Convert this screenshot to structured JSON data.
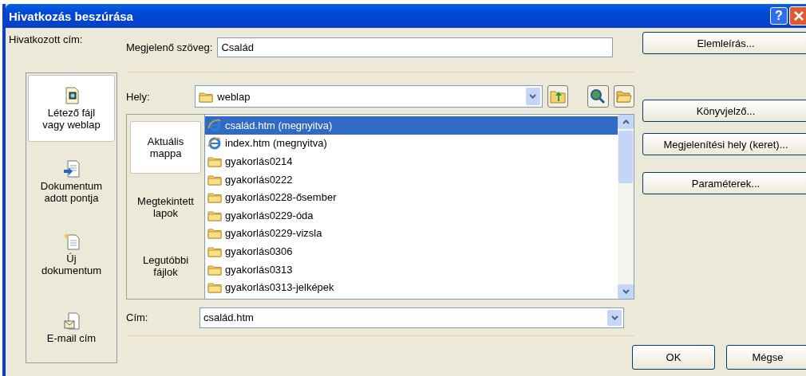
{
  "window": {
    "title": "Hivatkozás beszúrása",
    "help_button": "?"
  },
  "link_to": {
    "label": "Hivatkozott cím:",
    "items": [
      {
        "label": "Létező fájl\nvagy weblap",
        "kind": "file",
        "selected": true
      },
      {
        "label": "Dokumentum\nadott pontja",
        "kind": "place",
        "selected": false
      },
      {
        "label": "Új\ndokumentum",
        "kind": "new",
        "selected": false
      },
      {
        "label": "E-mail cím",
        "kind": "email",
        "selected": false
      }
    ]
  },
  "display_text": {
    "label": "Megjelenő szöveg:",
    "value": "Család"
  },
  "screen_tip_button": "Elemleírás...",
  "look_in": {
    "label": "Hely:",
    "value": "weblap"
  },
  "tabs": [
    {
      "label": "Aktuális\nmappa",
      "selected": true
    },
    {
      "label": "Megtekintett\nlapok",
      "selected": false
    },
    {
      "label": "Legutóbbi\nfájlok",
      "selected": false
    }
  ],
  "files": [
    {
      "name": "család.htm (megnyitva)",
      "kind": "web",
      "selected": true
    },
    {
      "name": "index.htm (megnyitva)",
      "kind": "web",
      "selected": false
    },
    {
      "name": "gyakorlás0214",
      "kind": "folder",
      "selected": false
    },
    {
      "name": "gyakorlás0222",
      "kind": "folder",
      "selected": false
    },
    {
      "name": "gyakorlás0228-ősember",
      "kind": "folder",
      "selected": false
    },
    {
      "name": "gyakorlás0229-óda",
      "kind": "folder",
      "selected": false
    },
    {
      "name": "gyakorlás0229-vizsla",
      "kind": "folder",
      "selected": false
    },
    {
      "name": "gyakorlás0306",
      "kind": "folder",
      "selected": false
    },
    {
      "name": "gyakorlás0313",
      "kind": "folder",
      "selected": false
    },
    {
      "name": "gyakorlás0313-jelképek",
      "kind": "folder",
      "selected": false
    }
  ],
  "address": {
    "label": "Cím:",
    "value": "család.htm"
  },
  "side_buttons": [
    "Könyvjelző...",
    "Megjelenítési hely (keret)...",
    "Paraméterek..."
  ],
  "buttons": [
    "OK",
    "Mégse"
  ]
}
